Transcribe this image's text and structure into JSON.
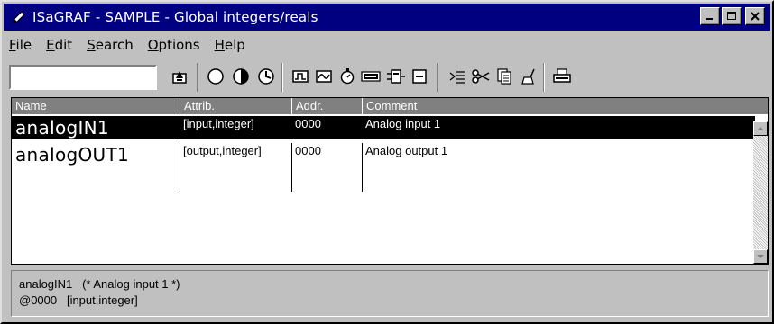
{
  "window": {
    "title": "ISaGRAF - SAMPLE - Global integers/reals",
    "icon": "pencil-icon",
    "controls": [
      "minimize",
      "maximize",
      "close"
    ]
  },
  "menu": [
    {
      "label": "File",
      "accel": "F",
      "rest": "ile"
    },
    {
      "label": "Edit",
      "accel": "E",
      "rest": "dit"
    },
    {
      "label": "Search",
      "accel": "S",
      "rest": "earch"
    },
    {
      "label": "Options",
      "accel": "O",
      "rest": "ptions"
    },
    {
      "label": "Help",
      "accel": "H",
      "rest": "elp"
    }
  ],
  "toolbar": {
    "filter_value": "",
    "tools": [
      "edit-variable-icon",
      "circle-empty-icon",
      "circle-half-icon",
      "circle-clock-icon",
      "pulse-icon",
      "wave-icon",
      "timer-icon",
      "xyz-icon",
      "function-block-icon",
      "box-icon",
      "insert-icon",
      "cut-icon",
      "copy-icon",
      "paste-icon",
      "print-icon"
    ]
  },
  "table": {
    "columns": [
      "Name",
      "Attrib.",
      "Addr.",
      "Comment"
    ],
    "rows": [
      {
        "name": "analogIN1",
        "attrib": "[input,integer]",
        "addr": "0000",
        "comment": "Analog input 1",
        "selected": true
      },
      {
        "name": "analogOUT1",
        "attrib": "[output,integer]",
        "addr": "0000",
        "comment": "Analog output 1",
        "selected": false
      }
    ]
  },
  "status": {
    "line1": "analogIN1   (* Analog input 1 *)",
    "line2": "@0000   [input,integer]"
  }
}
